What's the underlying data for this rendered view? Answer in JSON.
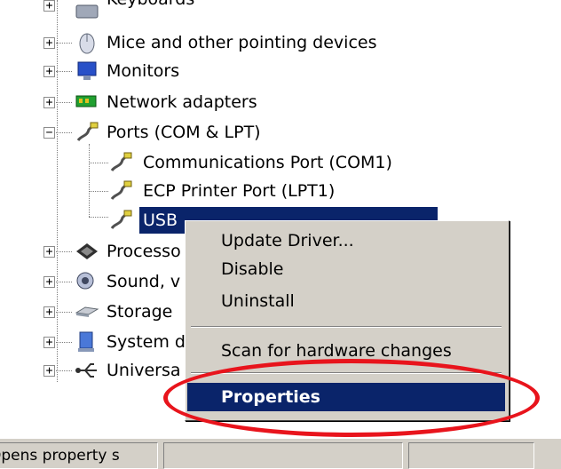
{
  "tree": {
    "items": [
      {
        "label": "Keyboards",
        "icon": "keyboard-icon"
      },
      {
        "label": "Mice and other pointing devices",
        "icon": "mouse-icon"
      },
      {
        "label": "Monitors",
        "icon": "monitor-icon"
      },
      {
        "label": "Network adapters",
        "icon": "network-adapter-icon"
      },
      {
        "label": "Ports (COM & LPT)",
        "icon": "port-icon"
      },
      {
        "label": "Communications Port (COM1)",
        "icon": "port-icon"
      },
      {
        "label": "ECP Printer Port (LPT1)",
        "icon": "port-icon"
      },
      {
        "label": "USB",
        "icon": "port-icon"
      },
      {
        "label": "Processo",
        "icon": "processor-icon"
      },
      {
        "label": "Sound, v",
        "icon": "sound-icon"
      },
      {
        "label": "Storage",
        "icon": "storage-icon"
      },
      {
        "label": "System d",
        "icon": "system-icon"
      },
      {
        "label": "Universa",
        "icon": "usb-icon"
      }
    ]
  },
  "context_menu": {
    "items": [
      {
        "label": "Update Driver..."
      },
      {
        "label": "Disable"
      },
      {
        "label": "Uninstall"
      },
      {
        "label": "Scan for hardware changes"
      },
      {
        "label": "Properties"
      }
    ]
  },
  "annotation": {
    "color": "#e8141c"
  },
  "status_bar": {
    "text": "Opens property s"
  },
  "colors": {
    "selection": "#0a246a",
    "menu_bg": "#d4d0c8"
  }
}
